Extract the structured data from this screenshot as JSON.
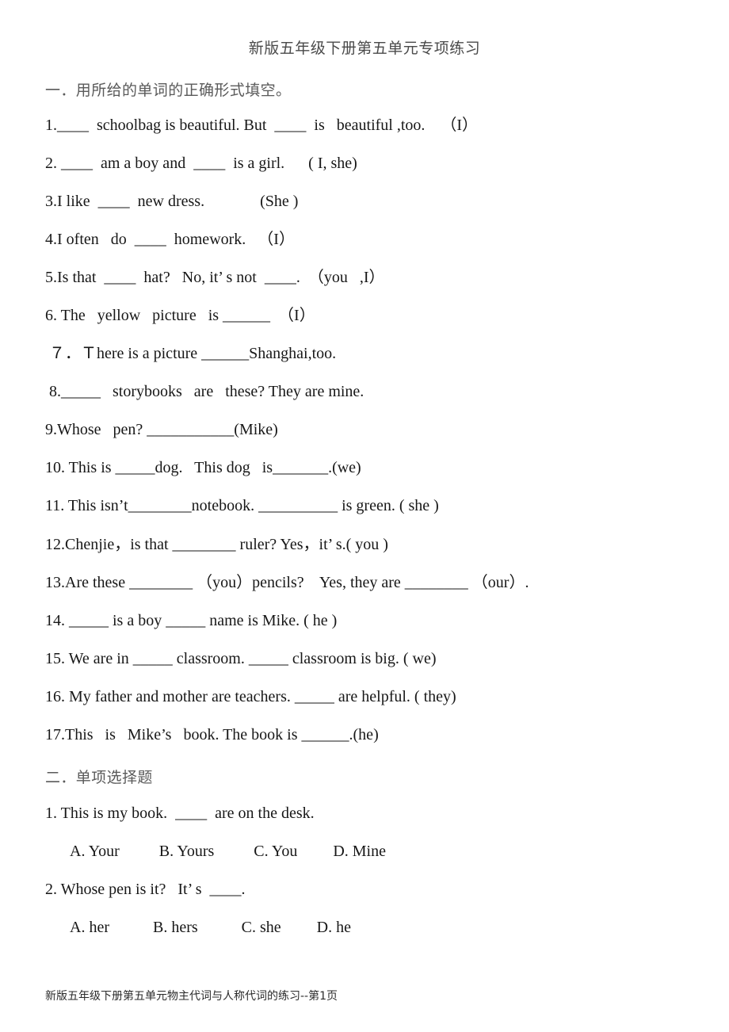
{
  "document": {
    "title": "新版五年级下册第五单元专项练习",
    "footer": "新版五年级下册第五单元物主代词与人称代词的练习--第1页"
  },
  "sections": [
    {
      "heading": "一．用所给的单词的正确形式填空。",
      "questions": [
        "1.____  schoolbag is beautiful. But  ____  is   beautiful ,too.    （I）",
        "2. ____  am a boy and  ____  is a girl.      ( I, she)",
        "3.I like  ____  new dress.              (She )",
        "4.I often   do  ____  homework.   （I）",
        "5.Is that  ____  hat?   No, it’ s not  ____.  （you   ,I）",
        "6. The   yellow   picture   is ______  （I）",
        "７．Ｔhere is a picture ______Shanghai,too.",
        "8._____   storybooks   are   these? They are mine.",
        "9.Whose   pen? ___________(Mike)",
        "10. This is _____dog.   This dog   is_______.(we)",
        "11. This isn’t________notebook. __________ is green. ( she )",
        "12.Chenjie，is that ________ ruler? Yes，it’ s.( you )",
        "13.Are these ________ （you）pencils?    Yes, they are ________ （our）.",
        "14. _____ is a boy _____ name is Mike. ( he )",
        "15. We are in _____ classroom. _____ classroom is big. ( we)",
        "16. My father and mother are teachers. _____ are helpful. ( they)",
        "17.This   is   Mike’s   book. The book is ______.(he)"
      ]
    },
    {
      "heading": "二．单项选择题",
      "items": [
        {
          "stem": "1. This is my book.  ____  are on the desk.",
          "options": "A. Your          B. Yours          C. You         D. Mine"
        },
        {
          "stem": "2. Whose pen is it?   It’ s  ____.",
          "options": "A. her           B. hers           C. she         D. he"
        }
      ]
    }
  ]
}
